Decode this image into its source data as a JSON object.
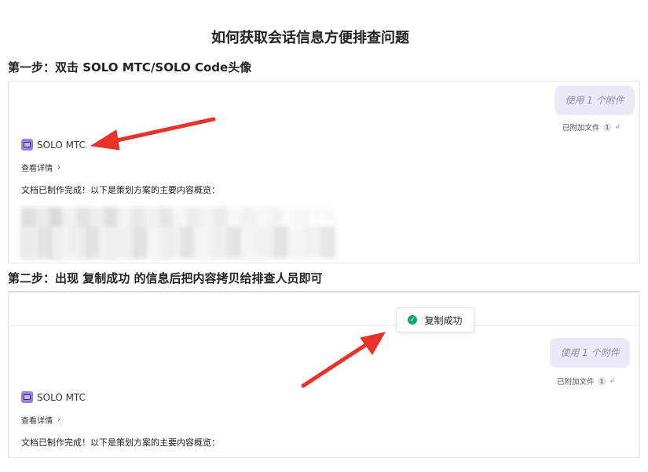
{
  "title": "如何获取会话信息方便排查问题",
  "step1": {
    "heading": "第一步：双击 SOLO MTC/SOLO Code头像",
    "bubble_text": "使用 1 个附件",
    "attach_label": "已附加文件",
    "attach_count": "1",
    "agent_name": "SOLO MTC",
    "details_label": "查看详情",
    "summary_text": "文档已制作完成！以下是策划方案的主要内容概览："
  },
  "step2": {
    "heading": "第二步：出现 复制成功 的信息后把内容拷贝给排查人员即可",
    "toast_text": "复制成功",
    "bubble_text": "使用 1 个附件",
    "attach_label": "已附加文件",
    "attach_count": "1",
    "agent_name": "SOLO MTC",
    "details_label": "查看详情",
    "summary_text": "文档已制作完成！以下是策划方案的主要内容概览："
  },
  "colors": {
    "arrow": "#e8332a",
    "bubble_bg": "#ebebf8",
    "agent_icon": "#9b7fe0",
    "success": "#1aa36b"
  },
  "icons": [
    "agent-avatar-icon",
    "chevron-right-icon",
    "check-circle-icon",
    "annotation-arrow"
  ]
}
